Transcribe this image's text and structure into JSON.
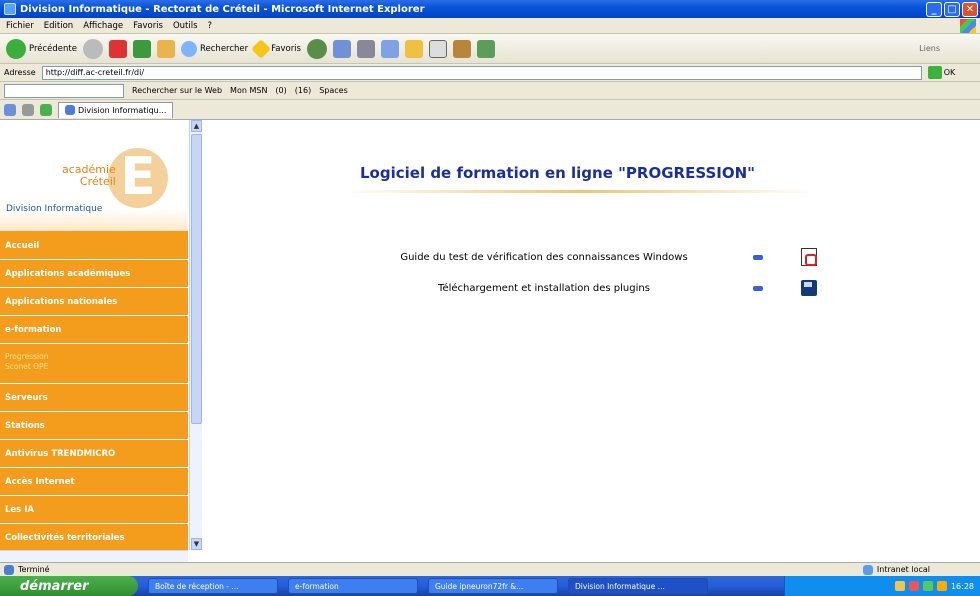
{
  "window": {
    "title": "Division Informatique - Rectorat de Créteil - Microsoft Internet Explorer",
    "buttons": [
      "_",
      "□",
      "✕"
    ]
  },
  "menubar": [
    "Fichier",
    "Edition",
    "Affichage",
    "Favoris",
    "Outils",
    "?"
  ],
  "toolbar": {
    "back_label": "Précédente",
    "search_label": "Rechercher",
    "favorites_label": "Favoris",
    "links_label": "Liens"
  },
  "address": {
    "label": "Adresse",
    "url": "http://diff.ac-creteil.fr/di/",
    "go_label": "OK"
  },
  "msnbar": {
    "search_web": "Rechercher sur le Web",
    "mon_msn": "Mon MSN",
    "count1": "(0)",
    "count2": "(16)",
    "spaces": "Spaces"
  },
  "tab": {
    "label": "Division Informatiqu..."
  },
  "sidebar": {
    "logo_line1": "académie",
    "logo_line2": "Créteil",
    "logo_letter": "E",
    "division_label": "Division Informatique",
    "items": [
      "Accueil",
      "Applications académiques",
      "Applications nationales",
      "e-formation"
    ],
    "sub_items": [
      "Progression",
      "Sconet OPE"
    ],
    "items2": [
      "Serveurs",
      "Stations",
      "Antivirus TRENDMICRO",
      "Accès Internet",
      "Les IA",
      "Collectivités territoriales"
    ]
  },
  "main": {
    "title": "Logiciel de formation en ligne \"PROGRESSION\"",
    "link1": "Guide du test de vérification des connaissances Windows",
    "link2": "Téléchargement et installation des plugins"
  },
  "status": {
    "text": "Terminé",
    "zone": "Intranet local"
  },
  "taskbar": {
    "start": "démarrer",
    "tasks": [
      "Boîte de réception - ...",
      "e-formation",
      "Guide ipneuron72fr &...",
      "Division Informatique ..."
    ],
    "clock": "16:28"
  }
}
